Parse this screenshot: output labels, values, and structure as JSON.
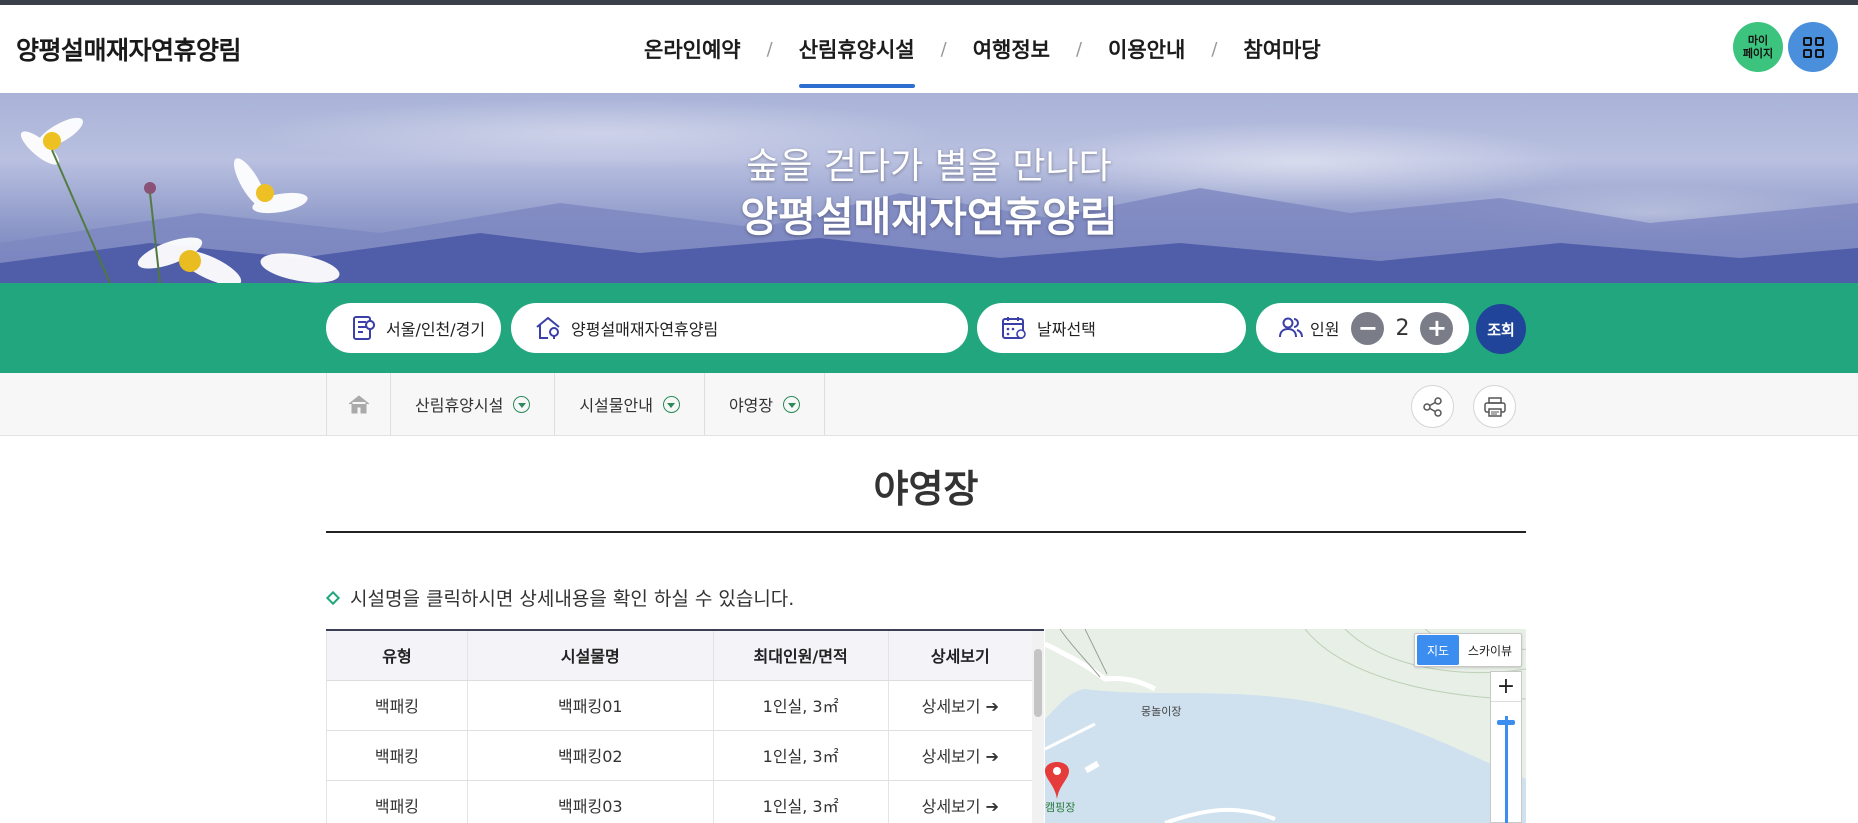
{
  "header": {
    "logo": "양평설매재자연휴양림",
    "nav": [
      {
        "label": "온라인예약"
      },
      {
        "label": "산림휴양시설",
        "active": true
      },
      {
        "label": "여행정보"
      },
      {
        "label": "이용안내"
      },
      {
        "label": "참여마당"
      }
    ],
    "separator": "/",
    "mypage_label": "마이\n페이지",
    "menu_icon": "grid-menu-icon"
  },
  "banner": {
    "subtitle": "숲을 걷다가 별을 만나다",
    "title": "양평설매재자연휴양림"
  },
  "search": {
    "region": "서울/인천/경기",
    "forest": "양평설매재자연휴양림",
    "date_placeholder": "날짜선택",
    "people_label": "인원",
    "people_count": "2",
    "minus": "−",
    "plus": "+",
    "submit_label": "조회"
  },
  "breadcrumb": {
    "items": [
      "산림휴양시설",
      "시설물안내",
      "야영장"
    ]
  },
  "content": {
    "page_title": "야영장",
    "notice": "시설명을 클릭하시면 상세내용을 확인 하실 수 있습니다.",
    "table": {
      "headers": [
        "유형",
        "시설물명",
        "최대인원/면적",
        "상세보기"
      ],
      "rows": [
        [
          "백패킹",
          "백패킹01",
          "1인실, 3㎡",
          "상세보기 ➔"
        ],
        [
          "백패킹",
          "백패킹02",
          "1인실, 3㎡",
          "상세보기 ➔"
        ],
        [
          "백패킹",
          "백패킹03",
          "1인실, 3㎡",
          "상세보기 ➔"
        ]
      ]
    }
  },
  "map": {
    "type_map": "지도",
    "type_skyview": "스카이뷰",
    "zoom_in": "+",
    "labels": [
      "몽놀이장",
      "캠핑장"
    ]
  },
  "colors": {
    "accent_green": "#22a67d",
    "nav_active": "#2d6fd0",
    "search_button": "#1f4499",
    "mypage": "#3cc47e",
    "menu_button": "#4a8fdc"
  }
}
